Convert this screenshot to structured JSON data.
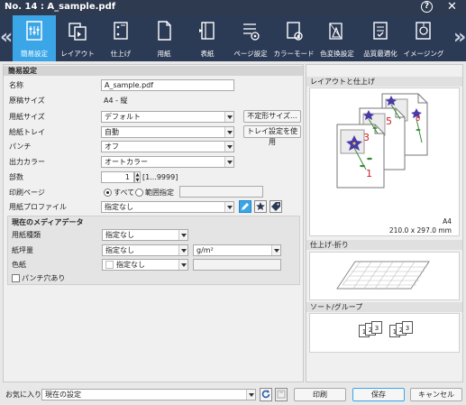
{
  "window": {
    "title": "No. 14 : A_sample.pdf",
    "help": "?",
    "close": "✕"
  },
  "toolbar": {
    "tabs": [
      {
        "label": "簡易設定",
        "icon": "basic-settings-icon"
      },
      {
        "label": "レイアウト",
        "icon": "layout-icon"
      },
      {
        "label": "仕上げ",
        "icon": "finishing-icon"
      },
      {
        "label": "用紙",
        "icon": "paper-icon"
      },
      {
        "label": "表紙",
        "icon": "cover-icon"
      },
      {
        "label": "ページ設定",
        "icon": "page-settings-icon"
      },
      {
        "label": "カラーモード",
        "icon": "color-mode-icon"
      },
      {
        "label": "色変換設定",
        "icon": "color-conversion-icon"
      },
      {
        "label": "品質最適化",
        "icon": "quality-icon"
      },
      {
        "label": "イメージング",
        "icon": "imaging-icon"
      }
    ],
    "active_tab": "簡易設定"
  },
  "basic": {
    "section_title": "簡易設定",
    "name_label": "名称",
    "name_value": "A_sample.pdf",
    "orig_size_label": "原稿サイズ",
    "orig_size_value": "A4 - 縦",
    "paper_size_label": "用紙サイズ",
    "paper_size_value": "デフォルト",
    "custom_size_button": "不定形サイズ...",
    "tray_label": "給紙トレイ",
    "tray_value": "自動",
    "tray_button": "トレイ設定を使用",
    "punch_label": "パンチ",
    "punch_value": "オフ",
    "color_label": "出力カラー",
    "color_value": "オートカラー",
    "copies_label": "部数",
    "copies_value": "1",
    "copies_range": "[1...9999]",
    "print_pages_label": "印刷ページ",
    "print_pages_all": "すべて",
    "print_pages_range": "範囲指定",
    "paper_profile_label": "用紙プロファイル",
    "paper_profile_value": "指定なし"
  },
  "media": {
    "title": "現在のメディアデータ",
    "type_label": "用紙種類",
    "type_value": "指定なし",
    "weight_label": "紙坪量",
    "weight_value": "指定なし",
    "weight_unit": "g/m²",
    "color_label": "色紙",
    "color_value": "指定なし",
    "punched_label": "パンチ穴あり"
  },
  "preview": {
    "layout_title": "レイアウトと仕上げ",
    "page_numbers": [
      "1",
      "3",
      "5",
      "6"
    ],
    "paper": "A4",
    "dims": "210.0 x 297.0 mm",
    "fold_title": "仕上げ-折り",
    "sort_title": "ソート/グループ",
    "sort_numbers": [
      "1",
      "2",
      "3",
      "1",
      "2",
      "3"
    ]
  },
  "footer": {
    "favorites_label": "お気に入り",
    "favorites_value": "現在の設定",
    "print_button": "印刷",
    "save_button": "保存",
    "cancel_button": "キャンセル"
  },
  "colors": {
    "titlebar": "#2e3a50",
    "toolbar": "#2b3a55",
    "active_tab": "#3aa6e8",
    "page_number_red": "#d02020",
    "flower_purple": "#4a3aa8"
  }
}
